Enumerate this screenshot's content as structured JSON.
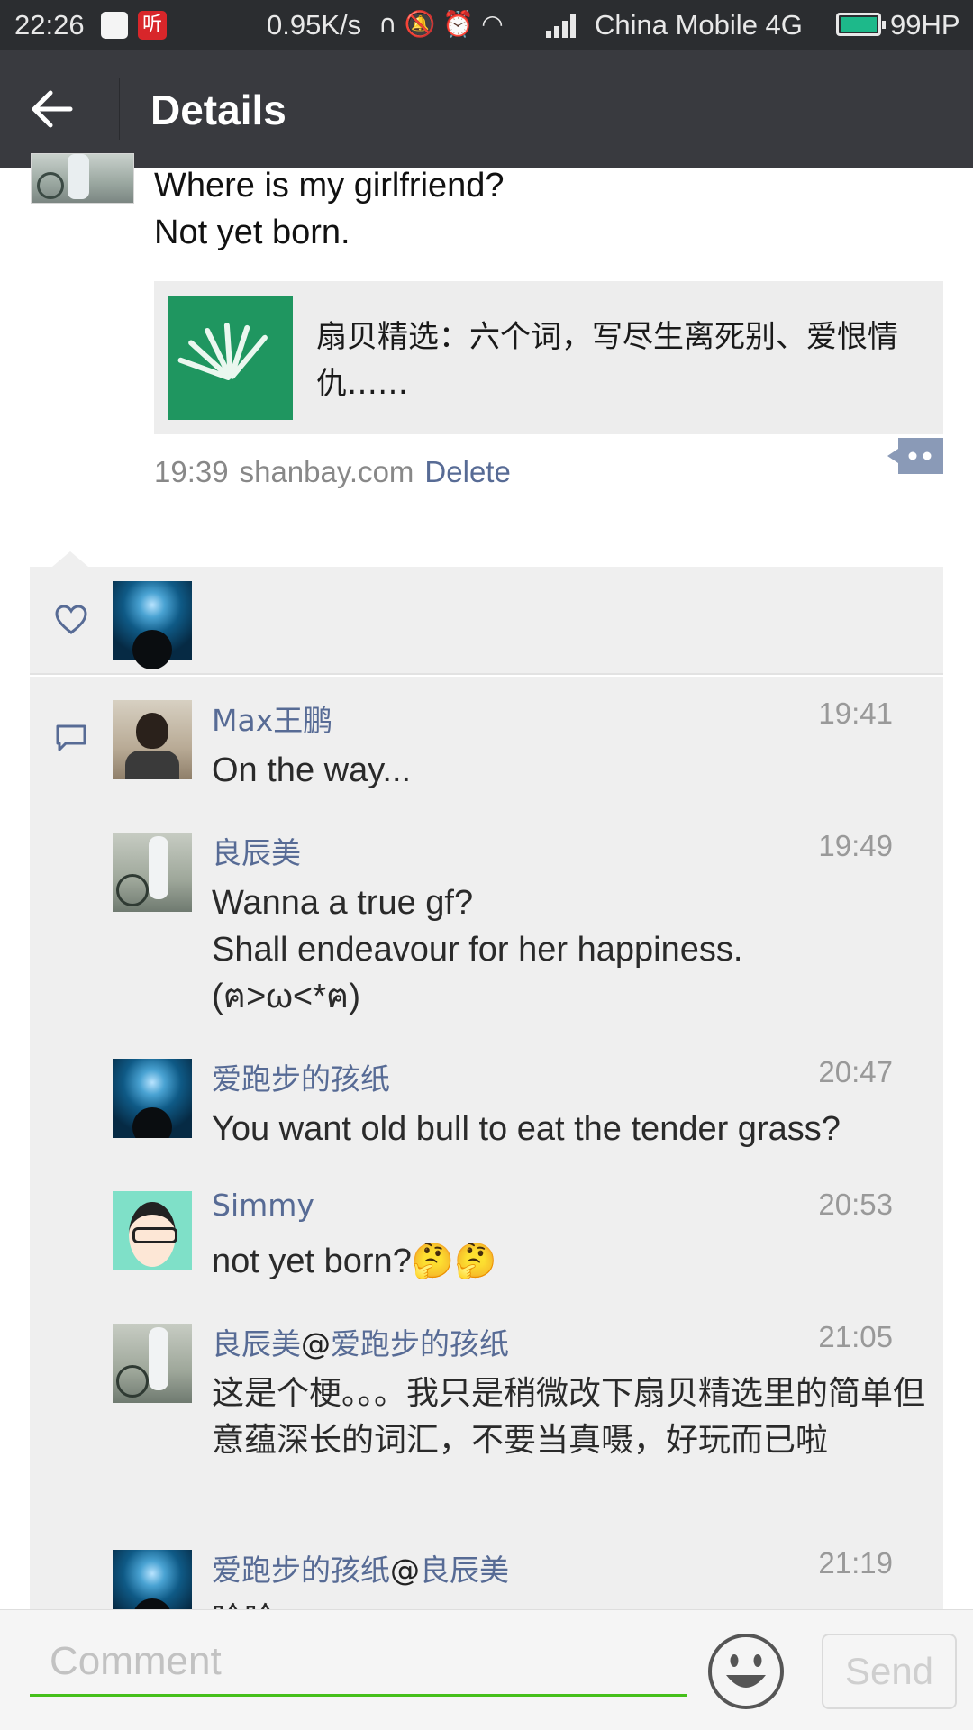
{
  "status_bar": {
    "time": "22:26",
    "app_badge": "听",
    "net_speed": "0.95K/s",
    "icons": [
      "headphones-icon",
      "mute-icon",
      "alarm-icon",
      "wifi-icon"
    ],
    "carrier": "China Mobile 4G",
    "battery_label": "99HP",
    "battery_level": 0.99,
    "battery_color": "#1db98a"
  },
  "header": {
    "title": "Details",
    "background": "#393a3f"
  },
  "post": {
    "lines": [
      "Where is my girlfriend?",
      "Not yet born."
    ],
    "link_card": {
      "title": "扇贝精选：六个词，写尽生离死别、爱恨情仇……",
      "thumb_color": "#1f9660"
    },
    "time": "19:39",
    "source": "shanbay.com",
    "delete_label": "Delete"
  },
  "accent_color": "#576b95",
  "comments": [
    {
      "name": "Max王鹏",
      "time": "19:41",
      "text": "On the way..."
    },
    {
      "name": "良辰美",
      "time": "19:49",
      "text": "Wanna a true gf?\nShall endeavour for her happiness.\n(ฅ>ω<*ฅ)"
    },
    {
      "name": "爱跑步的孩纸",
      "time": "20:47",
      "text": "You want old bull to eat the tender grass?"
    },
    {
      "name": "Simmy",
      "time": "20:53",
      "text": "not yet born?🤔🤔"
    },
    {
      "name": "良辰美",
      "reply_at": "@",
      "reply_to": "爱跑步的孩纸",
      "time": "21:05",
      "text": "这是个梗。。。我只是稍微改下扇贝精选里的简单但意蕴深长的词汇，不要当真嗫，好玩而已啦"
    },
    {
      "name": "爱跑步的孩纸",
      "reply_at": "@",
      "reply_to": "良辰美",
      "time": "21:19",
      "text": "哈哈"
    }
  ],
  "input": {
    "placeholder": "Comment",
    "send_label": "Send",
    "underline_color": "#45c01a"
  }
}
